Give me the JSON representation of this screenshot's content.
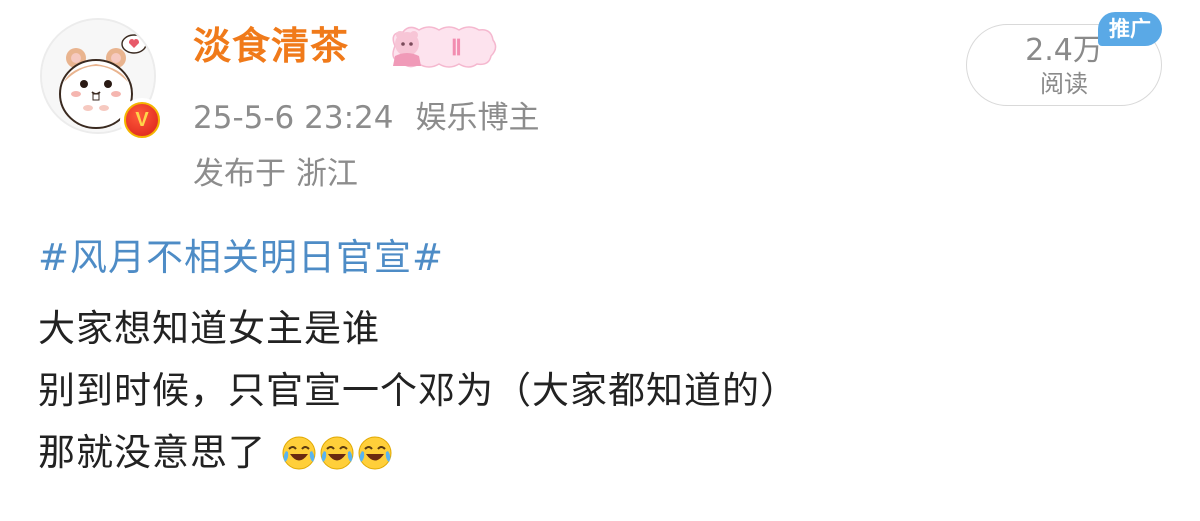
{
  "post": {
    "author": {
      "name": "淡食清茶",
      "verified": true,
      "badge_level": "Ⅱ",
      "avatar": "hamster-avatar"
    },
    "timestamp": "25-5-6 23:24",
    "role": "娱乐博主",
    "location": "发布于 浙江",
    "views": {
      "count": "2.4万",
      "label": "阅读"
    },
    "ad_tag": "推广",
    "topic": "#风月不相关明日官宣#",
    "lines": [
      "大家想知道女主是谁",
      "别到时候，只官宣一个邓为（大家都知道的）",
      "那就没意思了"
    ],
    "emojis": [
      "laugh-cry-emoji",
      "laugh-cry-emoji",
      "laugh-cry-emoji"
    ]
  },
  "colors": {
    "username": "#f07a1a",
    "topic": "#4e8cc6",
    "meta": "#8c8c8c",
    "ad_tag_bg": "#5aa9e6",
    "verified_badge": "#d9201a"
  }
}
